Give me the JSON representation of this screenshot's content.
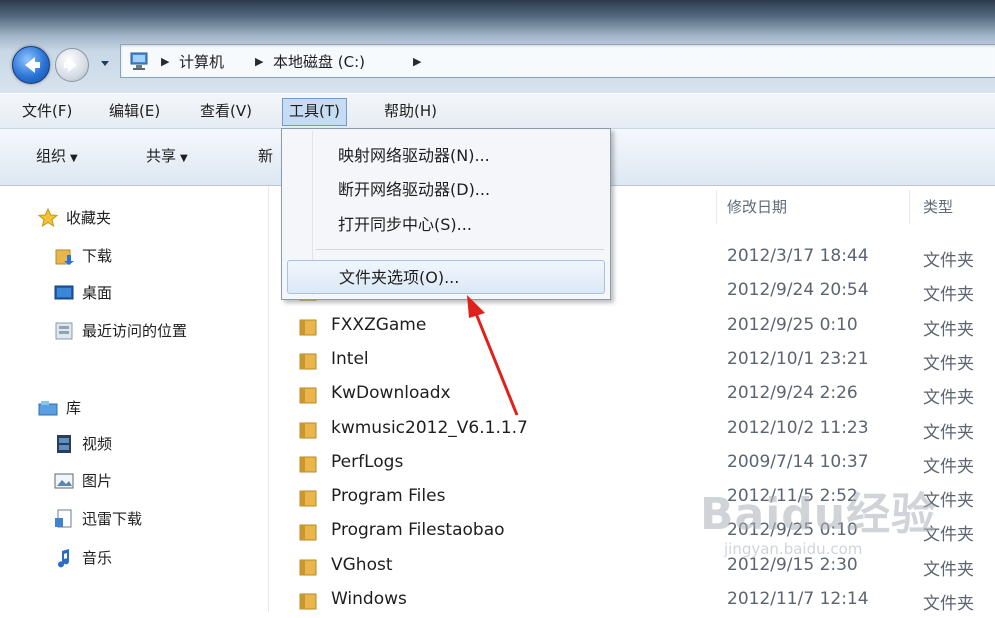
{
  "address_bar": {
    "crumbs": [
      "计算机",
      "本地磁盘 (C:)"
    ]
  },
  "menubar": {
    "items": [
      "文件(F)",
      "编辑(E)",
      "查看(V)",
      "工具(T)",
      "帮助(H)"
    ],
    "active": "工具(T)"
  },
  "toolbar": {
    "organize": "组织",
    "share": "共享",
    "new_partial": "新"
  },
  "tools_menu": {
    "items": [
      "映射网络驱动器(N)...",
      "断开网络驱动器(D)...",
      "打开同步中心(S)...",
      "文件夹选项(O)..."
    ],
    "highlighted": "文件夹选项(O)..."
  },
  "navpane": {
    "favorites": {
      "label": "收藏夹",
      "items": [
        "下载",
        "桌面",
        "最近访问的位置"
      ]
    },
    "libraries": {
      "label": "库",
      "items": [
        "视频",
        "图片",
        "迅雷下载",
        "音乐"
      ]
    }
  },
  "filelist": {
    "columns": {
      "date": "修改日期",
      "type": "类型"
    },
    "rows": [
      {
        "name": "",
        "date": "2012/3/17 18:44",
        "type": "文件夹"
      },
      {
        "name": "",
        "date": "2012/9/24 20:54",
        "type": "文件夹"
      },
      {
        "name": "FXXZGame",
        "date": "2012/9/25 0:10",
        "type": "文件夹"
      },
      {
        "name": "Intel",
        "date": "2012/10/1 23:21",
        "type": "文件夹"
      },
      {
        "name": "KwDownloadx",
        "date": "2012/9/24 2:26",
        "type": "文件夹"
      },
      {
        "name": "kwmusic2012_V6.1.1.7",
        "date": "2012/10/2 11:23",
        "type": "文件夹"
      },
      {
        "name": "PerfLogs",
        "date": "2009/7/14 10:37",
        "type": "文件夹"
      },
      {
        "name": "Program Files",
        "date": "2012/11/5 2:52",
        "type": "文件夹"
      },
      {
        "name": "Program Filestaobao",
        "date": "2012/9/25 0:10",
        "type": "文件夹"
      },
      {
        "name": "VGhost",
        "date": "2012/9/15 2:30",
        "type": "文件夹"
      },
      {
        "name": "Windows",
        "date": "2012/11/7 12:14",
        "type": "文件夹"
      }
    ]
  },
  "watermark": {
    "main": "Baidu经验",
    "sub": "jingyan.baidu.com"
  },
  "colors": {
    "accent": "#2a73d6",
    "menu_active": "#c6dcf3",
    "folder": "#e8b64a",
    "arrow": "#e0201a"
  }
}
